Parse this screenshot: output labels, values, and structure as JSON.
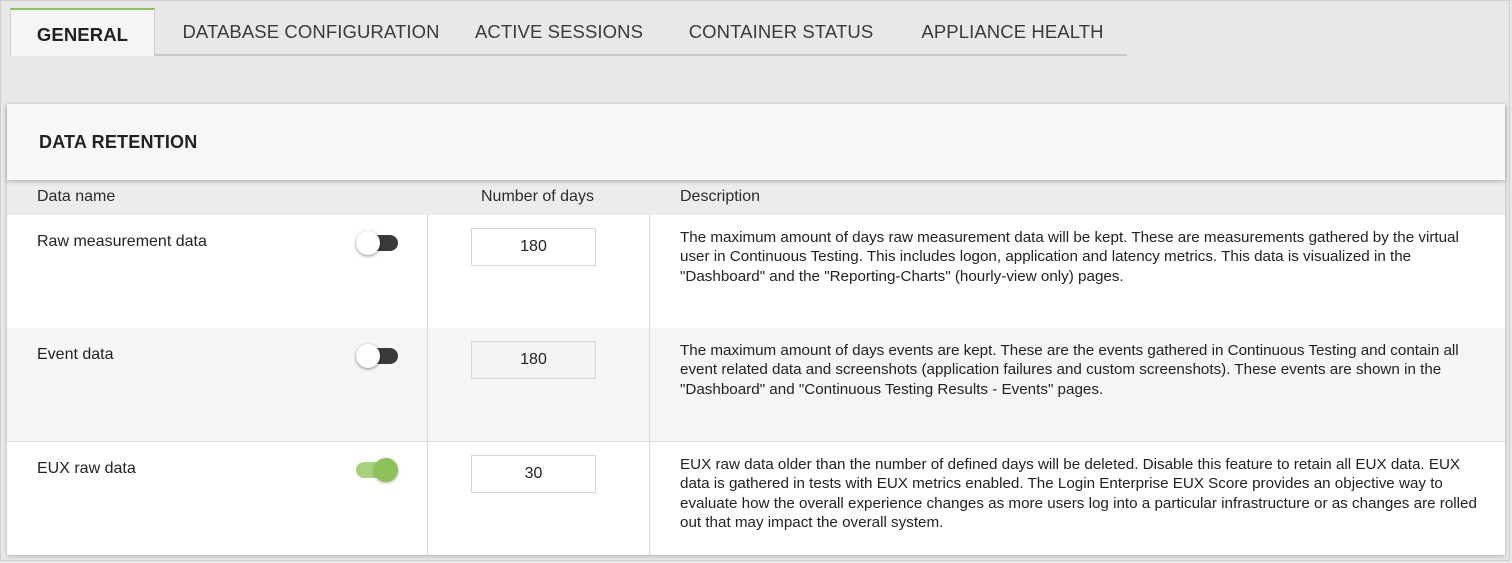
{
  "tabs": [
    {
      "label": "GENERAL",
      "active": true
    },
    {
      "label": "DATABASE CONFIGURATION",
      "active": false
    },
    {
      "label": "ACTIVE SESSIONS",
      "active": false
    },
    {
      "label": "CONTAINER STATUS",
      "active": false
    },
    {
      "label": "APPLIANCE HEALTH",
      "active": false
    }
  ],
  "card": {
    "title": "DATA RETENTION",
    "columns": {
      "name": "Data name",
      "days": "Number of days",
      "description": "Description"
    },
    "rows": [
      {
        "name": "Raw measurement data",
        "toggle_on": false,
        "days": "180",
        "description": "The maximum amount of days raw measurement data will be kept. These are measurements gathered by the virtual user in Continuous Testing. This includes logon, application and latency metrics. This data is visualized in the \"Dashboard\" and the \"Reporting-Charts\" (hourly-view only) pages."
      },
      {
        "name": "Event data",
        "toggle_on": false,
        "days": "180",
        "description": "The maximum amount of days events are kept. These are the events gathered in Continuous Testing and contain all event related data and screenshots (application failures and custom screenshots). These events are shown in the \"Dashboard\" and \"Continuous Testing Results - Events\" pages."
      },
      {
        "name": "EUX raw data",
        "toggle_on": true,
        "days": "30",
        "description": "EUX raw data older than the number of defined days will be deleted. Disable this feature to retain all EUX data. EUX data is gathered in tests with EUX metrics enabled. The Login Enterprise EUX Score provides an objective way to evaluate how the overall experience changes as more users log into a particular infrastructure or as changes are rolled out that may impact the overall system."
      }
    ]
  },
  "colors": {
    "accent": "#8dc159",
    "toggle_off_track": "#3a3a3a",
    "background": "#e8e8e8"
  }
}
